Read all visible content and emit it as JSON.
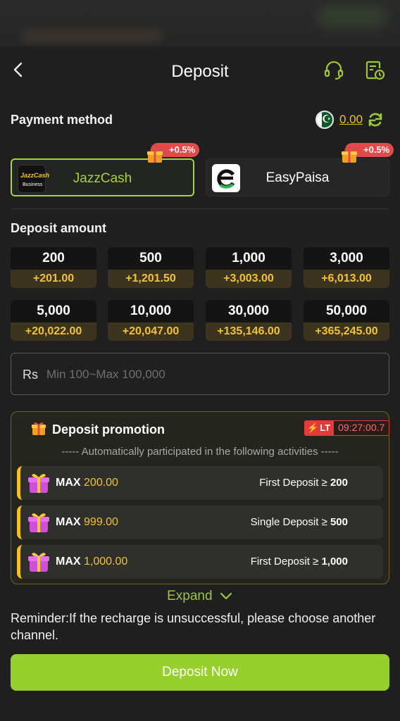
{
  "header": {
    "title": "Deposit"
  },
  "payment": {
    "label": "Payment method",
    "balance": "0.00",
    "methods": [
      {
        "name": "JazzCash",
        "bonus": "+0.5%",
        "active": true,
        "logo_text1": "JazzCash",
        "logo_text2": "Business"
      },
      {
        "name": "EasyPaisa",
        "bonus": "+0.5%",
        "active": false
      }
    ]
  },
  "amount": {
    "label": "Deposit amount",
    "options": [
      {
        "value": "200",
        "bonus": "+201.00"
      },
      {
        "value": "500",
        "bonus": "+1,201.50"
      },
      {
        "value": "1,000",
        "bonus": "+3,003.00"
      },
      {
        "value": "3,000",
        "bonus": "+6,013.00"
      },
      {
        "value": "5,000",
        "bonus": "+20,022.00"
      },
      {
        "value": "10,000",
        "bonus": "+20,047.00"
      },
      {
        "value": "30,000",
        "bonus": "+135,146.00"
      },
      {
        "value": "50,000",
        "bonus": "+365,245.00"
      }
    ],
    "currency": "Rs",
    "placeholder": "Min 100~Max 100,000"
  },
  "promotion": {
    "title": "Deposit promotion",
    "lt_label": "LT",
    "timer": "09:27:00.7",
    "subtitle": "----- Automatically participated in the following activities -----",
    "items": [
      {
        "max_label": "MAX",
        "max_value": "200.00",
        "condition": "First Deposit ≥",
        "threshold": "200"
      },
      {
        "max_label": "MAX",
        "max_value": "999.00",
        "condition": "Single Deposit ≥",
        "threshold": "500"
      },
      {
        "max_label": "MAX",
        "max_value": "1,000.00",
        "condition": "First Deposit ≥",
        "threshold": "1,000"
      }
    ]
  },
  "expand_label": "Expand",
  "reminder": "Reminder:If the recharge is unsuccessful, please choose another channel.",
  "deposit_button": "Deposit Now",
  "colors": {
    "accent_green": "#96cf2e",
    "gold": "#f2c230",
    "tag_red": "#e04a4a"
  }
}
